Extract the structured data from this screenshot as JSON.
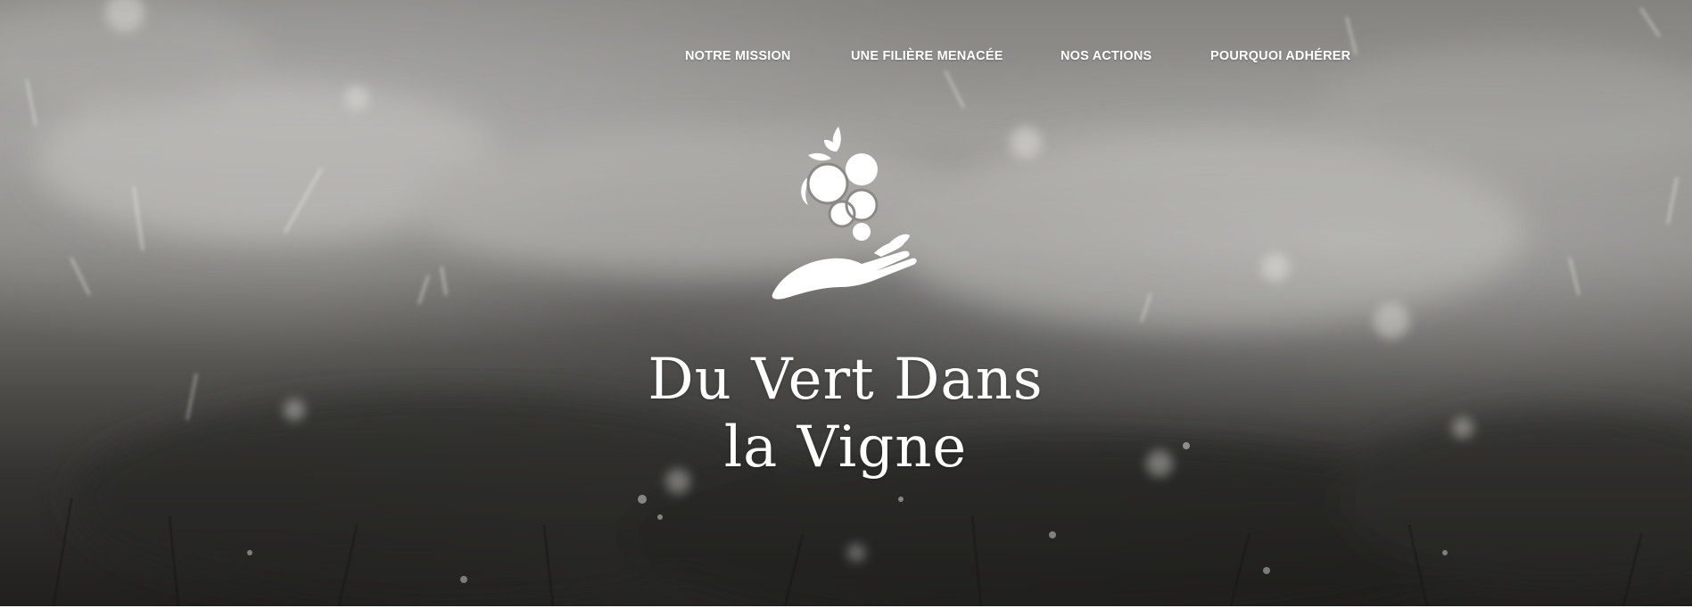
{
  "nav": {
    "items": [
      {
        "label": "NOTRE MISSION"
      },
      {
        "label": "UNE FILIÈRE MENACÉE"
      },
      {
        "label": "NOS ACTIONS"
      },
      {
        "label": "POURQUOI ADHÉRER"
      }
    ]
  },
  "hero": {
    "logo_icon": "grapes-on-hand-icon",
    "title_line1": "Du Vert Dans",
    "title_line2": "la Vigne"
  },
  "colors": {
    "text": "#ffffff",
    "background_tone": "#7f7e7a"
  }
}
